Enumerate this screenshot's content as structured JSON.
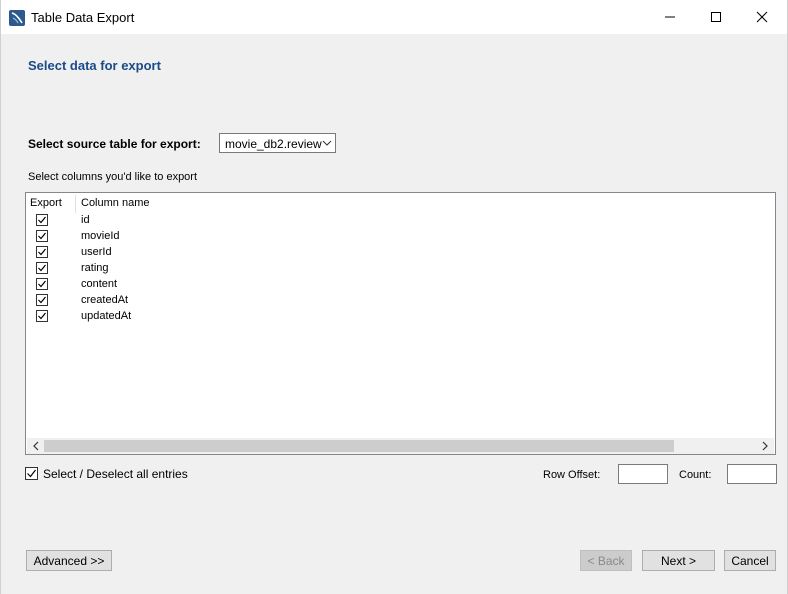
{
  "window": {
    "title": "Table Data Export",
    "controls": [
      "minimize-icon",
      "maximize-icon",
      "close-icon"
    ]
  },
  "page": {
    "heading": "Select data for export",
    "source_label": "Select source table for export:",
    "source_value": "movie_db2.review",
    "columns_label": "Select columns you'd like to export"
  },
  "table": {
    "headers": {
      "export": "Export",
      "column": "Column name"
    },
    "rows": [
      {
        "checked": true,
        "name": "id"
      },
      {
        "checked": true,
        "name": "movieId"
      },
      {
        "checked": true,
        "name": "userId"
      },
      {
        "checked": true,
        "name": "rating"
      },
      {
        "checked": true,
        "name": "content"
      },
      {
        "checked": true,
        "name": "createdAt"
      },
      {
        "checked": true,
        "name": "updatedAt"
      }
    ]
  },
  "footer": {
    "select_all_label": "Select / Deselect all entries",
    "select_all_checked": true,
    "row_offset_label": "Row Offset:",
    "row_offset_value": "",
    "count_label": "Count:",
    "count_value": ""
  },
  "buttons": {
    "advanced": "Advanced >>",
    "back": "< Back",
    "next": "Next >",
    "cancel": "Cancel"
  },
  "colors": {
    "heading": "#1a4a8a",
    "background": "#f0f0f0"
  }
}
